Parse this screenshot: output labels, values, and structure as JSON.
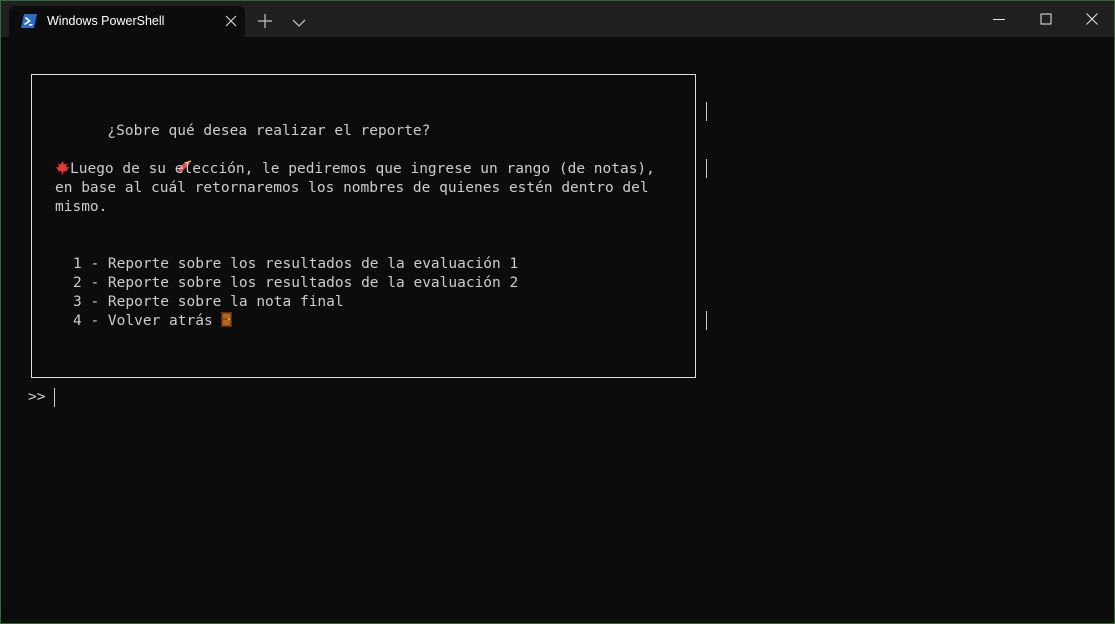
{
  "window": {
    "tab_title": "Windows PowerShell"
  },
  "icons": {
    "tab": "powershell-icon",
    "tab_close": "close-icon",
    "new_tab": "plus-icon",
    "dropdown": "chevron-down-icon",
    "minimize": "minimize-icon",
    "maximize": "maximize-icon",
    "close": "close-icon",
    "pencil": "hand-writing-icon",
    "maple_leaf": "maple-leaf-icon",
    "door": "door-icon"
  },
  "colors": {
    "terminal_bg": "#0c0c0c",
    "titlebar_bg": "#202020",
    "text": "#cccccc",
    "border": "#dedede",
    "window_border": "#2e6b3b",
    "accent_pencil": "#d9534f",
    "accent_leaf": "#e53935",
    "accent_door": "#b5651d"
  },
  "menu": {
    "question": "¿Sobre qué desea realizar el reporte?",
    "info_lines": [
      "Luego de su elección, le pediremos que ingrese un rango (de notas),",
      "en base al cuál retornaremos los nombres de quienes estén dentro del",
      "mismo."
    ],
    "options": [
      "1 - Reporte sobre los resultados de la evaluación 1",
      "2 - Reporte sobre los resultados de la evaluación 2",
      "3 - Reporte sobre la nota final",
      "4 - Volver atrás"
    ]
  },
  "prompt": {
    "symbol": ">>"
  }
}
